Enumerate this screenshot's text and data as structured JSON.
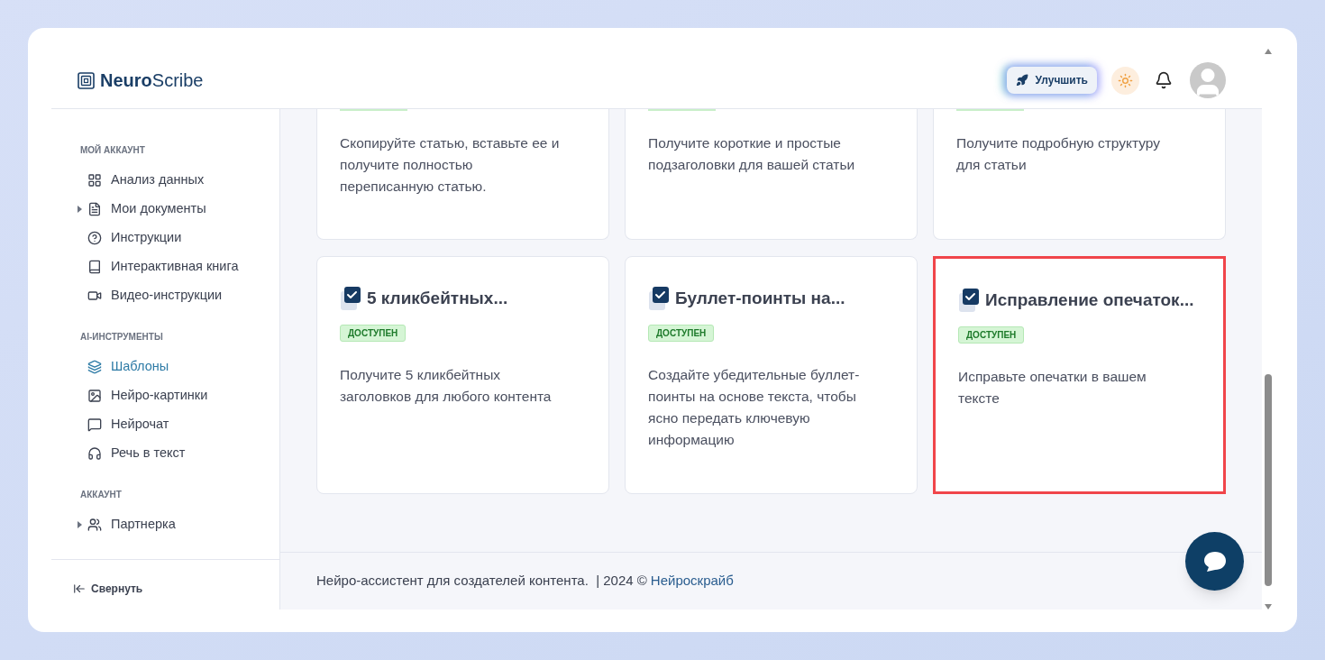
{
  "brand": {
    "bold": "Neuro",
    "rest": "Scribe"
  },
  "header": {
    "upgrade": "Улучшить"
  },
  "sidebar": {
    "sections": [
      {
        "title": "МОЙ АККАУНТ",
        "items": [
          {
            "label": "Анализ данных",
            "selected": false,
            "expandable": false
          },
          {
            "label": "Мои документы",
            "selected": false,
            "expandable": true
          },
          {
            "label": "Инструкции",
            "selected": false,
            "expandable": false
          },
          {
            "label": "Интерактивная книга",
            "selected": false,
            "expandable": false
          },
          {
            "label": "Видео-инструкции",
            "selected": false,
            "expandable": false
          }
        ]
      },
      {
        "title": "AI-ИНСТРУМЕНТЫ",
        "items": [
          {
            "label": "Шаблоны",
            "selected": true,
            "expandable": false
          },
          {
            "label": "Нейро-картинки",
            "selected": false,
            "expandable": false
          },
          {
            "label": "Нейрочат",
            "selected": false,
            "expandable": false
          },
          {
            "label": "Речь в текст",
            "selected": false,
            "expandable": false
          }
        ]
      },
      {
        "title": "АККАУНТ",
        "items": [
          {
            "label": "Партнерка",
            "selected": false,
            "expandable": true
          }
        ]
      }
    ],
    "collapse": "Свернуть"
  },
  "cards_top": [
    {
      "description": "Скопируйте статью, вставьте ее и получите полностью переписанную статью."
    },
    {
      "description": "Получите короткие и простые подзаголовки для вашей статьи"
    },
    {
      "description": "Получите подробную структуру для статьи"
    }
  ],
  "cards": [
    {
      "title": "5 кликбейтных...",
      "badge": "ДОСТУПЕН",
      "description": "Получите 5 кликбейтных заголовков для любого контента",
      "highlighted": false
    },
    {
      "title": "Буллет-поинты на...",
      "badge": "ДОСТУПЕН",
      "description": "Создайте убедительные буллет-поинты на основе текста, чтобы ясно передать ключевую информацию",
      "highlighted": false
    },
    {
      "title": "Исправление опечаток...",
      "badge": "ДОСТУПЕН",
      "description": "Исправьте опечатки в вашем тексте",
      "highlighted": true
    }
  ],
  "footer": {
    "text": "Нейро-ассистент для создателей контента.  | 2024 ©",
    "link": "Нейроскрайб"
  }
}
